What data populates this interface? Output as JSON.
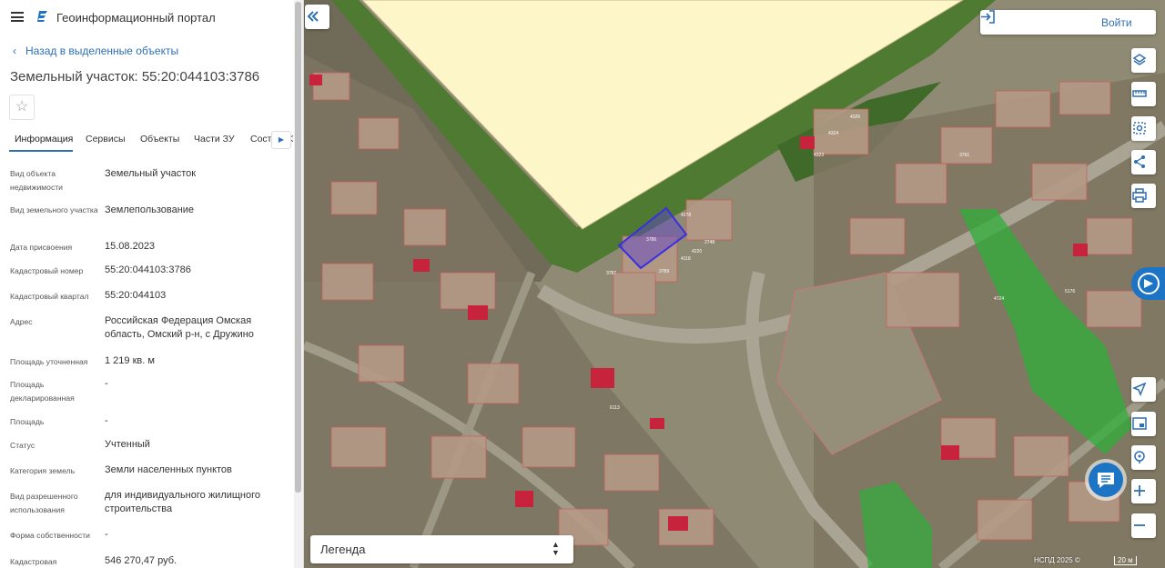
{
  "header": {
    "title": "Геоинформационный портал"
  },
  "nav": {
    "back_label": "Назад в выделенные объекты"
  },
  "object": {
    "title": "Земельный участок: 55:20:044103:3786"
  },
  "tabs": [
    {
      "label": "Информация"
    },
    {
      "label": "Сервисы"
    },
    {
      "label": "Объекты"
    },
    {
      "label": "Части ЗУ"
    },
    {
      "label": "Состав ЕЗП"
    }
  ],
  "properties": [
    {
      "label": "Вид объекта недвижимости",
      "value": "Земельный участок"
    },
    {
      "label": "Вид земельного участка",
      "value": "Землепользование"
    },
    {
      "label": "Дата присвоения",
      "value": "15.08.2023"
    },
    {
      "label": "Кадастровый номер",
      "value": "55:20:044103:3786"
    },
    {
      "label": "Кадастровый квартал",
      "value": "55:20:044103"
    },
    {
      "label": "Адрес",
      "value": "Российская Федерация Омская область, Омский р-н, с Дружино"
    },
    {
      "label": "Площадь уточненная",
      "value": "1 219 кв. м"
    },
    {
      "label": "Площадь декларированная",
      "value": "-"
    },
    {
      "label": "Площадь",
      "value": "-"
    },
    {
      "label": "Статус",
      "value": "Учтенный"
    },
    {
      "label": "Категория земель",
      "value": "Земли населенных пунктов"
    },
    {
      "label": "Вид разрешенного использования",
      "value": "для индивидуального жилищного строительства"
    },
    {
      "label": "Форма собственности",
      "value": "-"
    },
    {
      "label": "Кадастровая",
      "value": "546 270,47 руб."
    }
  ],
  "map": {
    "login_label": "Войти",
    "legend_label": "Легенда",
    "copyright": "НСПД 2025 ©",
    "scale_label": "20 м",
    "parcel_labels": [
      "3786",
      "3787",
      "4278",
      "4220",
      "4118",
      "3789",
      "4326",
      "3791",
      "4724",
      "2748",
      "6113",
      "4324",
      "4323",
      "5176"
    ],
    "colors": {
      "accent": "#2f6fb3",
      "selected_parcel": "#5a3fd0",
      "green_zone": "#2fae3a",
      "yellow_zone": "#fdf6c8"
    }
  }
}
